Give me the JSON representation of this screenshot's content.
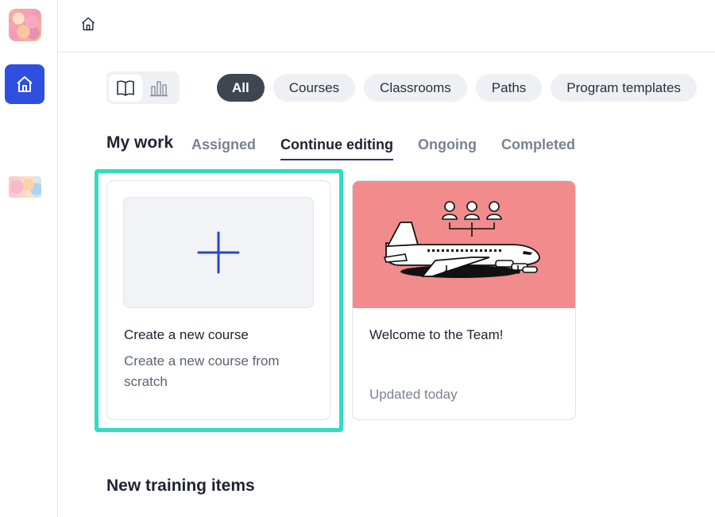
{
  "filters": {
    "all": "All",
    "courses": "Courses",
    "classrooms": "Classrooms",
    "paths": "Paths",
    "program_templates": "Program templates"
  },
  "my_work": {
    "heading": "My work",
    "tabs": [
      "Assigned",
      "Continue editing",
      "Ongoing",
      "Completed"
    ],
    "active_tab": "Continue editing"
  },
  "cards": {
    "create": {
      "title": "Create a new course",
      "description": "Create a new course from scratch"
    },
    "team": {
      "title": "Welcome to the Team!",
      "updated": "Updated today"
    }
  },
  "sections": {
    "new_training": "New training items"
  },
  "icons": {
    "sidebar_home": "home-icon",
    "top_home": "home-icon",
    "view_book": "book-icon",
    "view_chart": "bar-chart-icon",
    "create_plus": "plus-icon"
  },
  "colors": {
    "accent_blue": "#2f4fe0",
    "active_pill": "#3f4551",
    "highlight": "#2fdcc2",
    "card_image_bg": "#f28b8b",
    "tab_underline": "#23307a"
  }
}
